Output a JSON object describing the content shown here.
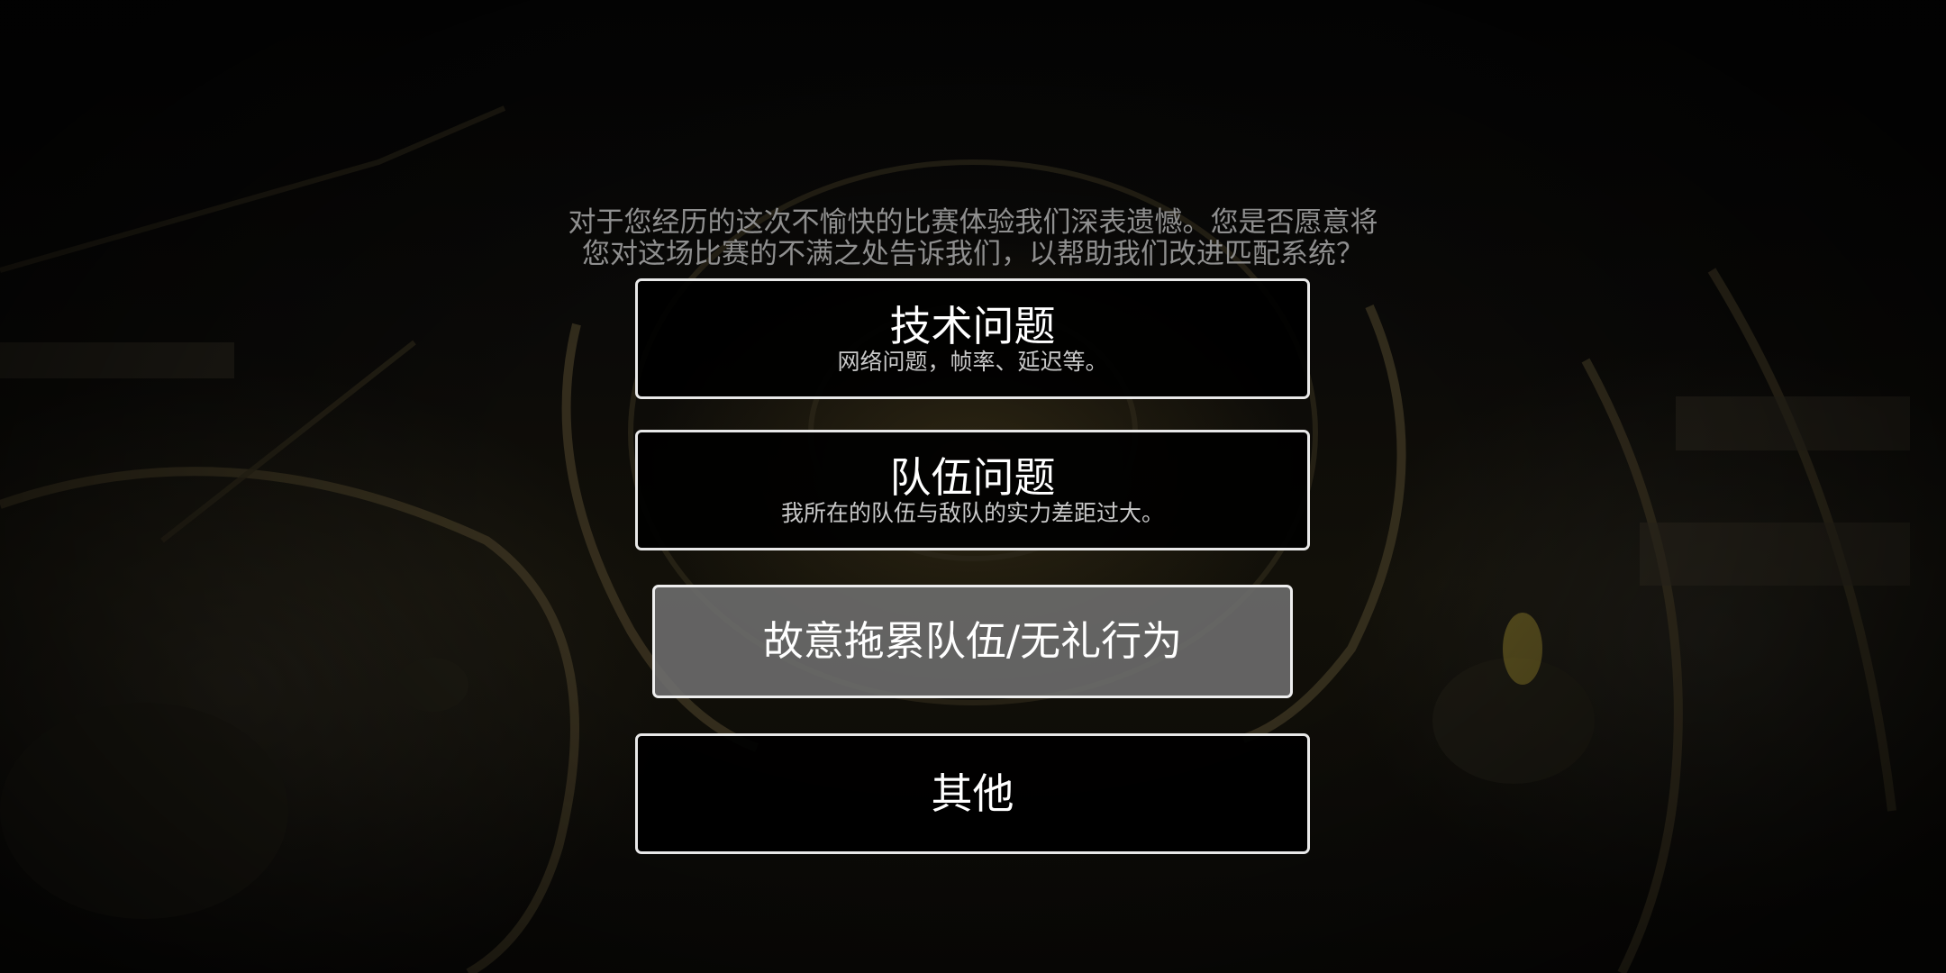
{
  "prompt": {
    "line1": "对于您经历的这次不愉快的比赛体验我们深表遗憾。您是否愿意将",
    "line2": "您对这场比赛的不满之处告诉我们，以帮助我们改进匹配系统？"
  },
  "options": [
    {
      "title": "技术问题",
      "description": "网络问题，帧率、延迟等。"
    },
    {
      "title": "队伍问题",
      "description": "我所在的队伍与敌队的实力差距过大。"
    },
    {
      "title": "故意拖累队伍/无礼行为",
      "selected": true
    },
    {
      "title": "其他"
    }
  ],
  "colors": {
    "border": "#e8e8e8",
    "selected_background": "#6e6e6e",
    "option_background": "#000000",
    "prompt_text": "#8f8f8f"
  }
}
